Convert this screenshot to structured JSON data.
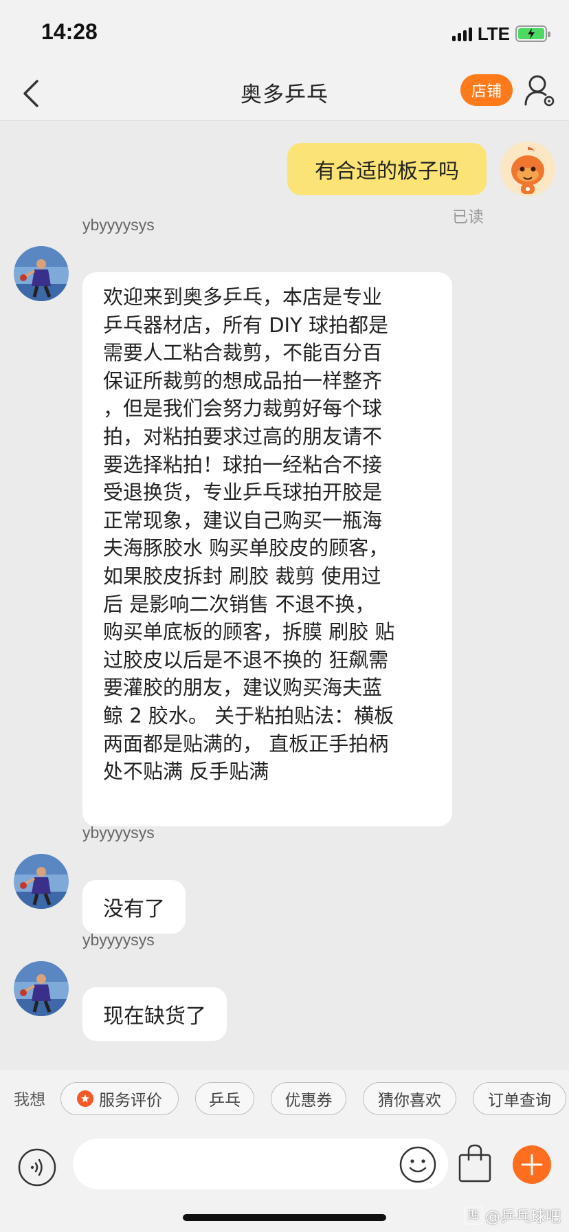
{
  "status_bar": {
    "time": "14:28",
    "network": "LTE"
  },
  "header": {
    "title": "奥多乒乓",
    "shop_button": "店铺"
  },
  "messages": [
    {
      "side": "right",
      "text": "有合适的板子吗",
      "status": "已读"
    },
    {
      "side": "left",
      "sender": "ybyyyysys",
      "lines": [
        "欢迎来到奥多乒乓，本店是专业",
        "乒乓器材店，所有 DIY 球拍都是",
        "需要人工粘合裁剪，不能百分百",
        "保证所裁剪的想成品拍一样整齐",
        "，但是我们会努力裁剪好每个球",
        "拍，对粘拍要求过高的朋友请不",
        "要选择粘拍！球拍一经粘合不接",
        "受退换货，专业乒乓球拍开胶是",
        "正常现象，建议自己购买一瓶海",
        "夫海豚胶水 购买单胶皮的顾客，",
        "如果胶皮拆封 刷胶 裁剪 使用过",
        "后 是影响二次销售 不退不换，",
        "购买单底板的顾客，拆膜 刷胶 贴",
        "过胶皮以后是不退不换的 狂飙需",
        "要灌胶的朋友，建议购买海夫蓝",
        "鲸 2 胶水。 关于粘拍贴法：横板",
        "两面都是贴满的， 直板正手拍柄",
        "处不贴满 反手贴满"
      ]
    },
    {
      "side": "left",
      "sender": "ybyyyysys",
      "text": "没有了"
    },
    {
      "side": "left",
      "sender": "ybyyyysys",
      "text": "现在缺货了"
    }
  ],
  "quick_bar": {
    "label": "我想",
    "chips": [
      "服务评价",
      "乒乓",
      "优惠券",
      "猜你喜欢",
      "订单查询"
    ]
  },
  "input": {
    "placeholder": ""
  },
  "watermark": {
    "logo_text": "贴",
    "text": "@乒乓球吧"
  },
  "icons": {
    "back": "chevron-left-icon",
    "profile": "user-settings-icon",
    "voice": "voice-icon",
    "emoji": "emoji-icon",
    "bag": "shopping-bag-icon",
    "plus": "plus-icon"
  },
  "colors": {
    "accent_orange": "#ff7a1a",
    "my_bubble": "#fbe475",
    "other_bubble": "#ffffff",
    "background": "#ebebeb"
  }
}
